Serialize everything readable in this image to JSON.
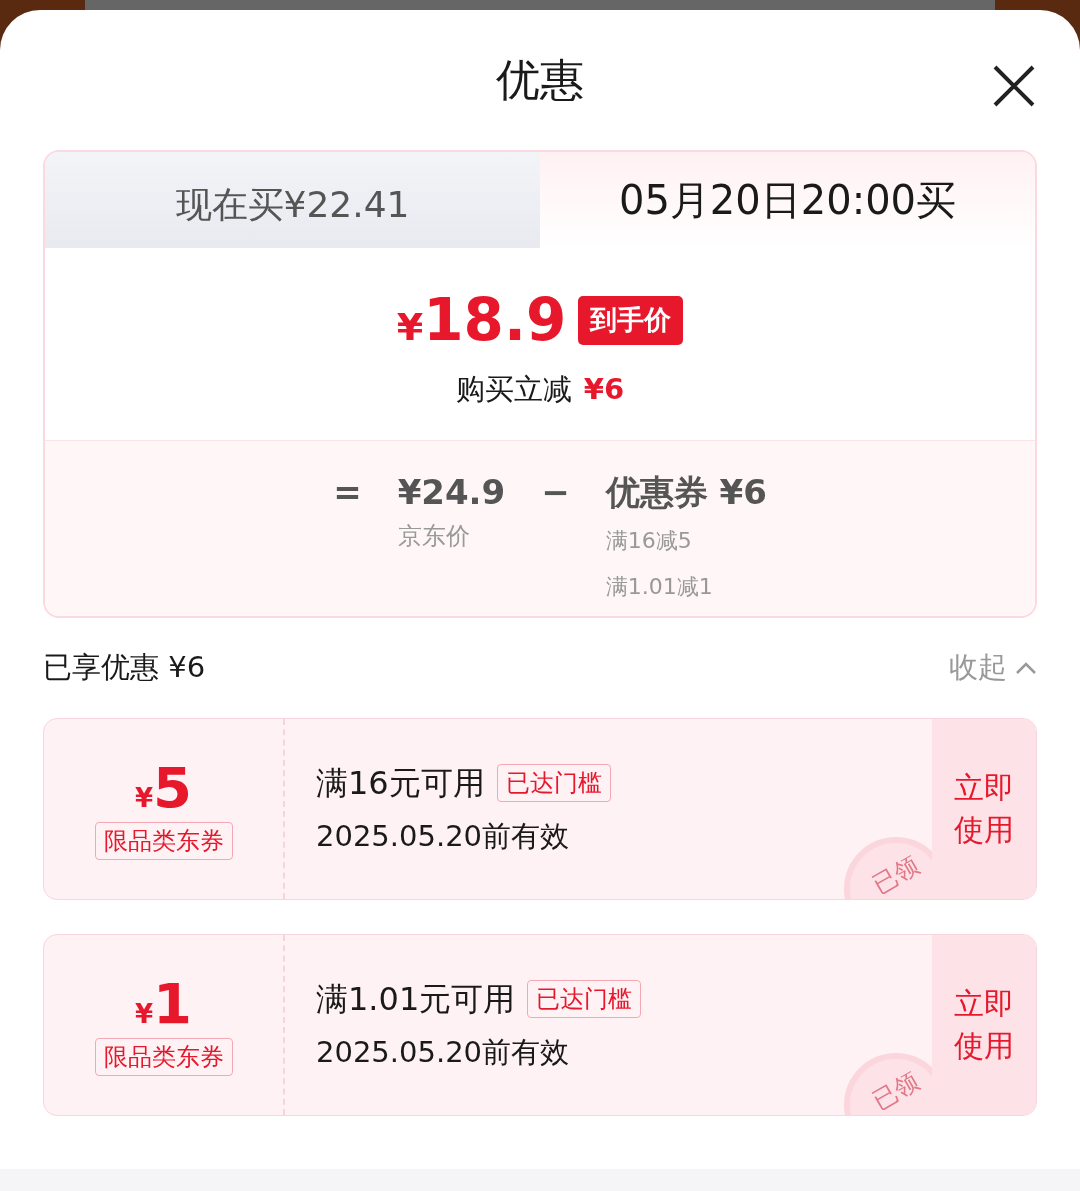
{
  "sheet": {
    "title": "优惠"
  },
  "tabs": [
    {
      "label": "现在买¥22.41",
      "selected": false
    },
    {
      "label": "05月20日20:00买",
      "selected": true
    }
  ],
  "price": {
    "currency": "¥",
    "amount": "18.9",
    "badge": "到手价",
    "saving_label": "购买立减",
    "saving_amount": "¥6"
  },
  "breakdown": {
    "equals": "=",
    "base_amount": "¥24.9",
    "base_label": "京东价",
    "minus": "−",
    "discount_amount": "优惠券 ¥6",
    "discount_details": [
      "满16减5",
      "满1.01减1"
    ]
  },
  "summary": {
    "label": "已享优惠 ¥6",
    "toggle": "收起",
    "expanded": true
  },
  "coupons": [
    {
      "currency": "¥",
      "amount": "5",
      "type": "限品类东券",
      "condition": "满16元可用",
      "tag": "已达门槛",
      "validity": "2025.05.20前有效",
      "action": "立即使用",
      "stamp": "已领"
    },
    {
      "currency": "¥",
      "amount": "1",
      "type": "限品类东券",
      "condition": "满1.01元可用",
      "tag": "已达门槛",
      "validity": "2025.05.20前有效",
      "action": "立即使用",
      "stamp": "已领"
    }
  ]
}
